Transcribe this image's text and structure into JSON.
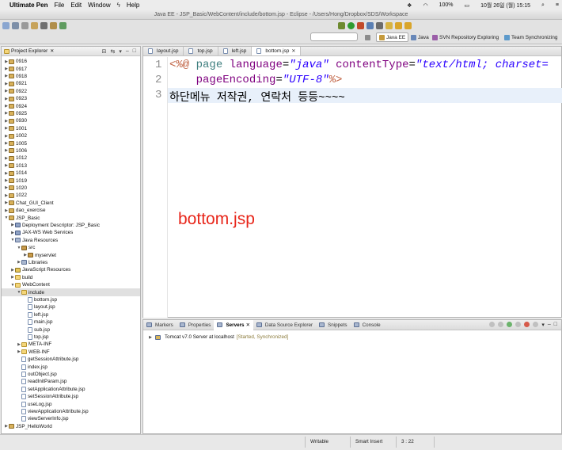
{
  "menubar": {
    "app": "Ultimate Pen",
    "items": [
      "File",
      "Edit",
      "Window",
      "Help"
    ],
    "battery": "100%",
    "clock": "10월 26일 (월)  15:15"
  },
  "window": {
    "title": "Java EE - JSP_Basic/WebContent/include/bottom.jsp - Eclipse - /Users/Hong/Dropbox/SDS/Workspace"
  },
  "perspectives": [
    "Java EE",
    "Java",
    "SVN Repository Exploring",
    "Team Synchronizing"
  ],
  "explorer": {
    "title": "Project Explorer",
    "rows": [
      {
        "label": "0916",
        "indent": 0,
        "icon": "proj",
        "arrow": "▶",
        "y": 0
      },
      {
        "label": "0917",
        "indent": 0,
        "icon": "proj",
        "arrow": "▶",
        "y": 1
      },
      {
        "label": "0918",
        "indent": 0,
        "icon": "proj",
        "arrow": "▶",
        "y": 2
      },
      {
        "label": "0921",
        "indent": 0,
        "icon": "proj",
        "arrow": "▶",
        "y": 3
      },
      {
        "label": "0922",
        "indent": 0,
        "icon": "proj",
        "arrow": "▶",
        "y": 4
      },
      {
        "label": "0923",
        "indent": 0,
        "icon": "proj",
        "arrow": "▶",
        "y": 5
      },
      {
        "label": "0924",
        "indent": 0,
        "icon": "proj",
        "arrow": "▶",
        "y": 6
      },
      {
        "label": "0925",
        "indent": 0,
        "icon": "proj",
        "arrow": "▶",
        "y": 7
      },
      {
        "label": "0930",
        "indent": 0,
        "icon": "proj",
        "arrow": "▶",
        "y": 8
      },
      {
        "label": "1001",
        "indent": 0,
        "icon": "proj",
        "arrow": "▶",
        "y": 9
      },
      {
        "label": "1002",
        "indent": 0,
        "icon": "proj",
        "arrow": "▶",
        "y": 10
      },
      {
        "label": "1005",
        "indent": 0,
        "icon": "proj",
        "arrow": "▶",
        "y": 11
      },
      {
        "label": "1006",
        "indent": 0,
        "icon": "proj",
        "arrow": "▶",
        "y": 12
      },
      {
        "label": "1012",
        "indent": 0,
        "icon": "proj",
        "arrow": "▶",
        "y": 13
      },
      {
        "label": "1013",
        "indent": 0,
        "icon": "proj",
        "arrow": "▶",
        "y": 14
      },
      {
        "label": "1014",
        "indent": 0,
        "icon": "proj",
        "arrow": "▶",
        "y": 15
      },
      {
        "label": "1019",
        "indent": 0,
        "icon": "proj",
        "arrow": "▶",
        "y": 16
      },
      {
        "label": "1020",
        "indent": 0,
        "icon": "proj",
        "arrow": "▶",
        "y": 17
      },
      {
        "label": "1022",
        "indent": 0,
        "icon": "proj",
        "arrow": "▶",
        "y": 18
      },
      {
        "label": "Chat_GUI_Client",
        "indent": 0,
        "icon": "proj",
        "arrow": "▶",
        "y": 19
      },
      {
        "label": "dao_exercise",
        "indent": 0,
        "icon": "proj",
        "arrow": "▶",
        "y": 20
      },
      {
        "label": "JSP_Basic",
        "indent": 0,
        "icon": "proj",
        "arrow": "▼",
        "y": 21
      },
      {
        "label": "Deployment Descriptor: JSP_Basic",
        "indent": 1,
        "icon": "dd",
        "arrow": "▶",
        "y": 22
      },
      {
        "label": "JAX-WS Web Services",
        "indent": 1,
        "icon": "dd",
        "arrow": "▶",
        "y": 23
      },
      {
        "label": "Java Resources",
        "indent": 1,
        "icon": "lib",
        "arrow": "▼",
        "y": 24
      },
      {
        "label": "src",
        "indent": 2,
        "icon": "pkg",
        "arrow": "▼",
        "y": 25
      },
      {
        "label": "myservlet",
        "indent": 3,
        "icon": "pkg",
        "arrow": "▶",
        "y": 26
      },
      {
        "label": "Libraries",
        "indent": 2,
        "icon": "lib",
        "arrow": "▶",
        "y": 27
      },
      {
        "label": "JavaScript Resources",
        "indent": 1,
        "icon": "js",
        "arrow": "▶",
        "y": 28
      },
      {
        "label": "build",
        "indent": 1,
        "icon": "folder",
        "arrow": "▶",
        "y": 29
      },
      {
        "label": "WebContent",
        "indent": 1,
        "icon": "folder",
        "arrow": "▼",
        "y": 30
      },
      {
        "label": "include",
        "indent": 2,
        "icon": "folder",
        "arrow": "▼",
        "y": 31,
        "selected": true
      },
      {
        "label": "bottom.jsp",
        "indent": 3,
        "icon": "file",
        "arrow": "",
        "y": 32
      },
      {
        "label": "layout.jsp",
        "indent": 3,
        "icon": "file",
        "arrow": "",
        "y": 33
      },
      {
        "label": "left.jsp",
        "indent": 3,
        "icon": "file",
        "arrow": "",
        "y": 34
      },
      {
        "label": "main.jsp",
        "indent": 3,
        "icon": "file",
        "arrow": "",
        "y": 35
      },
      {
        "label": "sub.jsp",
        "indent": 3,
        "icon": "file",
        "arrow": "",
        "y": 36
      },
      {
        "label": "top.jsp",
        "indent": 3,
        "icon": "file",
        "arrow": "",
        "y": 37
      },
      {
        "label": "META-INF",
        "indent": 2,
        "icon": "folder",
        "arrow": "▶",
        "y": 38
      },
      {
        "label": "WEB-INF",
        "indent": 2,
        "icon": "folder",
        "arrow": "▶",
        "y": 39
      },
      {
        "label": "getSessionAttribute.jsp",
        "indent": 2,
        "icon": "file",
        "arrow": "",
        "y": 40
      },
      {
        "label": "index.jsp",
        "indent": 2,
        "icon": "file",
        "arrow": "",
        "y": 41
      },
      {
        "label": "outObject.jsp",
        "indent": 2,
        "icon": "file",
        "arrow": "",
        "y": 42
      },
      {
        "label": "readInitParam.jsp",
        "indent": 2,
        "icon": "file",
        "arrow": "",
        "y": 43
      },
      {
        "label": "setApplicationAttribute.jsp",
        "indent": 2,
        "icon": "file",
        "arrow": "",
        "y": 44
      },
      {
        "label": "setSessionAttribute.jsp",
        "indent": 2,
        "icon": "file",
        "arrow": "",
        "y": 45
      },
      {
        "label": "useLog.jsp",
        "indent": 2,
        "icon": "file",
        "arrow": "",
        "y": 46
      },
      {
        "label": "viewApplicationAttribute.jsp",
        "indent": 2,
        "icon": "file",
        "arrow": "",
        "y": 47
      },
      {
        "label": "viewServerInfo.jsp",
        "indent": 2,
        "icon": "file",
        "arrow": "",
        "y": 48
      },
      {
        "label": "JSP_HelloWorld",
        "indent": 0,
        "icon": "proj",
        "arrow": "▶",
        "y": 49
      }
    ]
  },
  "editor": {
    "tabs": [
      "layout.jsp",
      "top.jsp",
      "left.jsp",
      "bottom.jsp"
    ],
    "active_tab": "bottom.jsp",
    "line_numbers": [
      "1",
      "2",
      "3"
    ],
    "line1": {
      "open": "<%@",
      "kw": "page",
      "attr1": "language",
      "eq1": "=",
      "val1": "\"java\"",
      "attr2": "contentType",
      "eq2": "=",
      "val2": "\"text/html; charset="
    },
    "line2": {
      "attr": "pageEncoding",
      "eq": "=",
      "val": "\"UTF-8\"",
      "close": "%>"
    },
    "line3": "하단메뉴 저작권, 연락처 등등~~~~",
    "overlay_label": "bottom.jsp"
  },
  "bottom_panel": {
    "tabs": [
      "Markers",
      "Properties",
      "Servers",
      "Data Source Explorer",
      "Snippets",
      "Console"
    ],
    "active_tab": "Servers",
    "server_name": "Tomcat v7.0 Server at localhost",
    "server_state": "[Started, Synchronized]"
  },
  "status": {
    "writable": "Writable",
    "insert_mode": "Smart Insert",
    "position": "3 : 22"
  },
  "colors": {
    "jsp_delimiter": "#bf5f3f",
    "jsp_keyword": "#3f7f7f",
    "attr_name": "#7f007f",
    "string": "#2a00ff",
    "overlay_red": "#e8261a"
  }
}
